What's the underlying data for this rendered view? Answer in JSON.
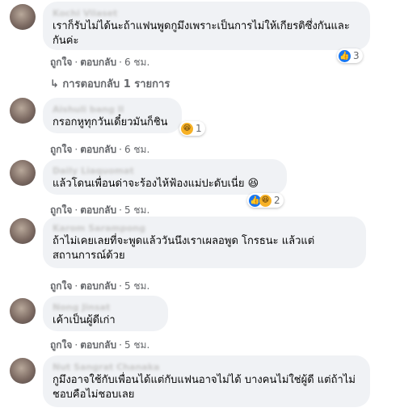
{
  "comments": [
    {
      "name": "Kochi Vilaset",
      "text": "เราก็รับไม่ได้นะถ้าแฟนพูดกูมึงเพราะเป็นการไม่ให้เกียรติซึ่งกันและกันค่ะ",
      "reactions": {
        "icons": [
          "like-icon"
        ],
        "count": "3"
      },
      "actions": {
        "like": "ถูกใจ",
        "reply": "ตอบกลับ",
        "time": "6 ชม."
      }
    },
    {
      "name": "Aishuli bang ll",
      "text": "กรอกหูทุกวันเดี๋ยวมันก็ชิน",
      "reactions": {
        "icons": [
          "haha-icon"
        ],
        "count": "1"
      },
      "actions": {
        "like": "ถูกใจ",
        "reply": "ตอบกลับ",
        "time": "6 ชม."
      }
    },
    {
      "name": "Daily Liaquomat",
      "text": "แล้วโดนเพื่อนด่าจะร้องไห้ฟ้องแม่ปะดับเนี่ย 😆",
      "reactions": {
        "icons": [
          "like-icon",
          "haha-icon"
        ],
        "count": "2"
      },
      "actions": {
        "like": "ถูกใจ",
        "reply": "ตอบกลับ",
        "time": "5 ชม."
      }
    },
    {
      "name": "Karom Sarampong",
      "text": "ถ้าไม่เคยเลยที่จะพูดแล้ววันนึงเราเผลอพูด โกรธนะ แล้วแต่สถานการณ์ด้วย",
      "reactions": null,
      "actions": {
        "like": "ถูกใจ",
        "reply": "ตอบกลับ",
        "time": "5 ชม."
      }
    },
    {
      "name": "Nong Jinsat",
      "text": "เค้าเป็นผู้ดีเก่า",
      "reactions": null,
      "actions": {
        "like": "ถูกใจ",
        "reply": "ตอบกลับ",
        "time": "5 ชม."
      }
    },
    {
      "name": "Nut Sangrat Chanaka",
      "text": "กูมึงอาจใช้กับเพื่อนได้แต่กับแฟนอาจไม่ได้ บางคนไม่ใช่ผู้ดี แต่ถ้าไม่ชอบคือไม่ชอบเลย",
      "reactions": null,
      "actions": null
    }
  ],
  "replies_link": "↳ การตอบกลับ 1 รายการ",
  "colors": {
    "bubble": "#f0f2f5",
    "like": "#1877f2",
    "haha": "#f7b125",
    "meta": "#65676b"
  }
}
